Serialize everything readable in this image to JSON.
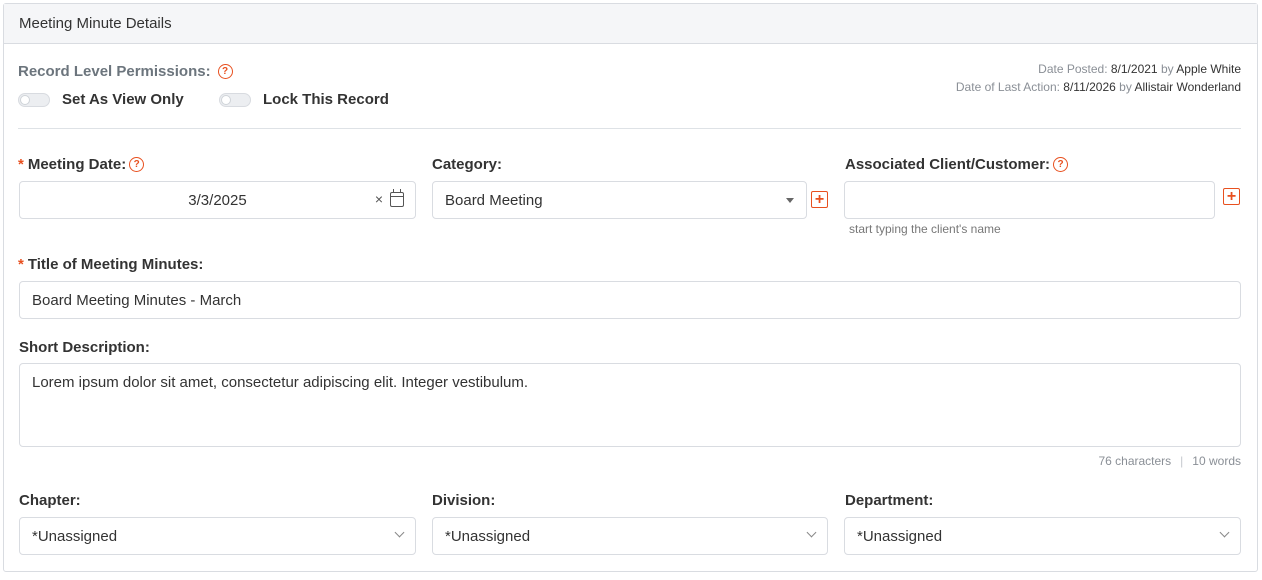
{
  "panel": {
    "title": "Meeting Minute Details"
  },
  "permissions": {
    "label": "Record Level Permissions:",
    "view_only_label": "Set As View Only",
    "lock_label": "Lock This Record"
  },
  "meta": {
    "posted_prefix": "Date Posted:",
    "posted_date": "8/1/2021",
    "posted_by_word": "by",
    "posted_by": "Apple White",
    "last_action_prefix": "Date of Last Action:",
    "last_action_date": "8/11/2026",
    "last_action_by_word": "by",
    "last_action_by": "Allistair Wonderland"
  },
  "fields": {
    "meeting_date": {
      "label": "Meeting Date:",
      "value": "3/3/2025",
      "clear": "×"
    },
    "category": {
      "label": "Category:",
      "value": "Board Meeting"
    },
    "client": {
      "label": "Associated Client/Customer:",
      "value": "",
      "hint": "start typing the client's name"
    },
    "title": {
      "label": "Title of Meeting Minutes:",
      "value": "Board Meeting Minutes - March"
    },
    "description": {
      "label": "Short Description:",
      "value": "Lorem ipsum dolor sit amet, consectetur adipiscing elit. Integer vestibulum.",
      "chars": "76 characters",
      "sep": "|",
      "words": "10 words"
    },
    "chapter": {
      "label": "Chapter:",
      "value": "*Unassigned"
    },
    "division": {
      "label": "Division:",
      "value": "*Unassigned"
    },
    "department": {
      "label": "Department:",
      "value": "*Unassigned"
    }
  },
  "icons": {
    "help": "?",
    "add": "+",
    "required": "*"
  },
  "colors": {
    "accent": "#e8501f",
    "border": "#d9dce1",
    "header_bg": "#f5f6f8"
  }
}
